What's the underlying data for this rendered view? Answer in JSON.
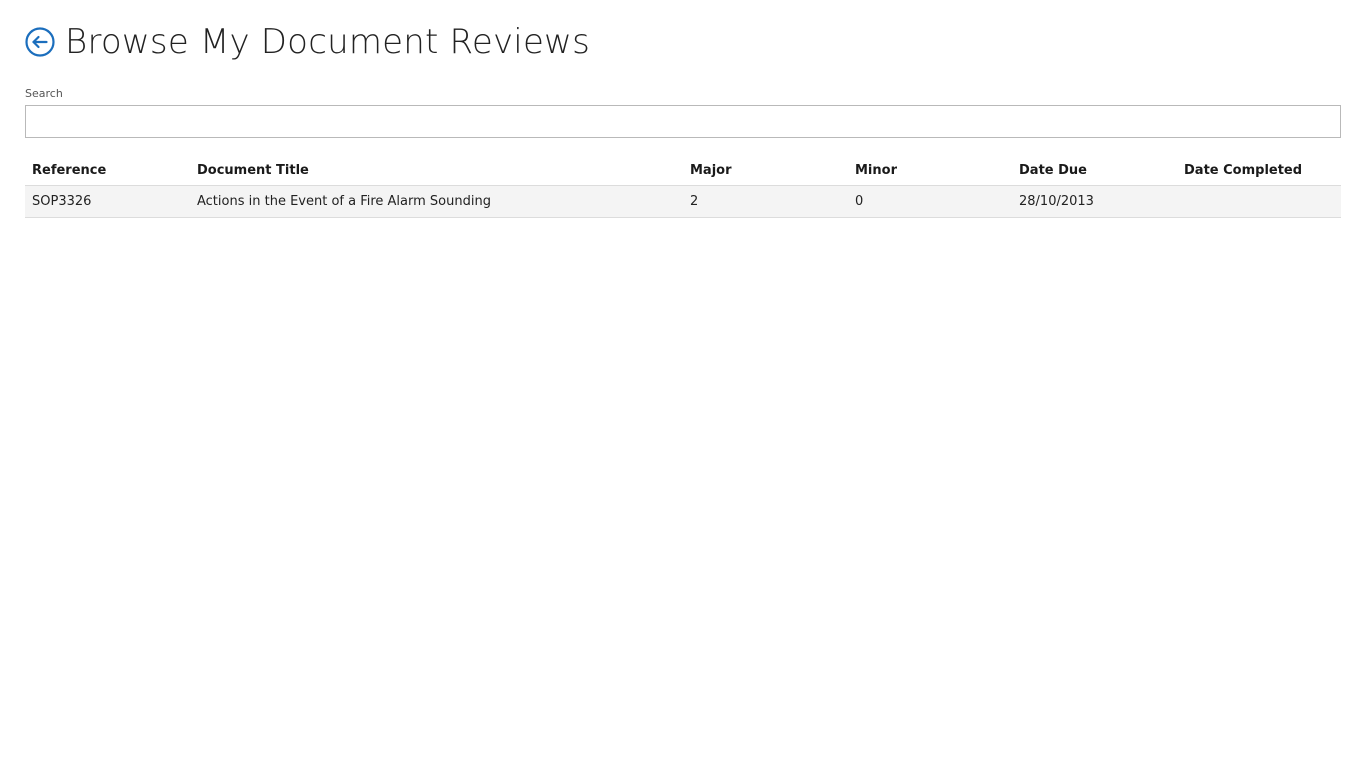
{
  "page": {
    "title": "Browse My Document Reviews",
    "accent_color": "#1b6ebd",
    "back_icon": "arrow-left-circle-icon"
  },
  "search": {
    "label": "Search",
    "value": "",
    "placeholder": ""
  },
  "table": {
    "columns": [
      "Reference",
      "Document Title",
      "Major",
      "Minor",
      "Date Due",
      "Date Completed"
    ],
    "rows": [
      {
        "reference": "SOP3326",
        "document_title": "Actions in the Event of a Fire Alarm Sounding",
        "major": "2",
        "minor": "0",
        "date_due": "28/10/2013",
        "date_completed": ""
      }
    ]
  }
}
